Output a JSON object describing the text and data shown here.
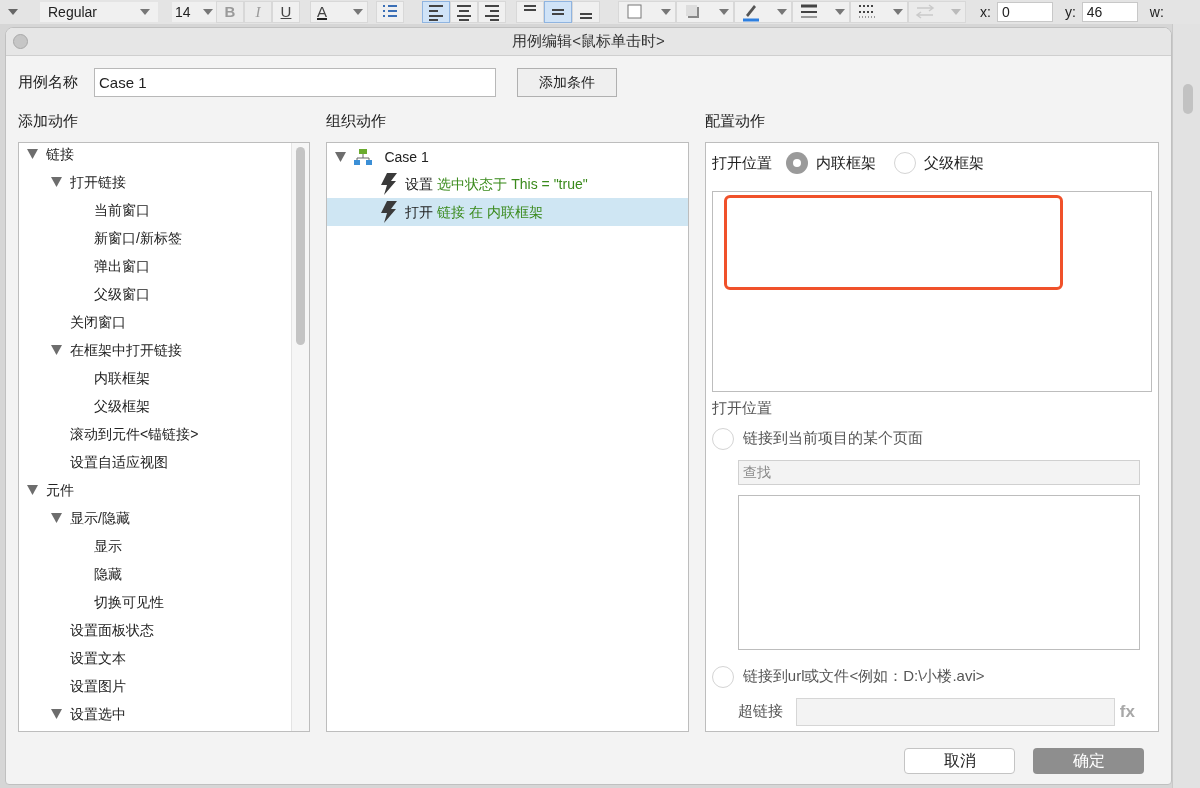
{
  "toolbar": {
    "font_style": "Regular",
    "font_size": "14",
    "buttons": [
      {
        "kind": "bold",
        "label": "B",
        "disabled": true,
        "selected": false
      },
      {
        "kind": "italic",
        "label": "I",
        "disabled": true,
        "selected": false
      },
      {
        "kind": "underline",
        "label": "U",
        "disabled": false,
        "selected": false
      },
      {
        "kind": "text-color",
        "label": "A",
        "disabled": false,
        "selected": false
      },
      {
        "kind": "list",
        "disabled": false,
        "selected": false
      },
      {
        "kind": "align-left",
        "disabled": false,
        "selected": true
      },
      {
        "kind": "align-center",
        "disabled": false,
        "selected": false
      },
      {
        "kind": "align-right",
        "disabled": false,
        "selected": false
      },
      {
        "kind": "valign-top",
        "disabled": false,
        "selected": false
      },
      {
        "kind": "valign-middle",
        "disabled": false,
        "selected": true
      },
      {
        "kind": "valign-bottom",
        "disabled": false,
        "selected": false
      },
      {
        "kind": "fill",
        "disabled": false,
        "selected": false
      },
      {
        "kind": "shadow",
        "disabled": false,
        "selected": false
      },
      {
        "kind": "line-color",
        "disabled": false,
        "selected": false
      },
      {
        "kind": "line-weight",
        "disabled": false,
        "selected": false
      },
      {
        "kind": "line-style",
        "disabled": false,
        "selected": false
      },
      {
        "kind": "arrow-style",
        "disabled": true,
        "selected": false
      }
    ],
    "x_label": "x:",
    "x_value": "0",
    "y_label": "y:",
    "y_value": "46",
    "w_label": "w:"
  },
  "dialog": {
    "title": "用例编辑<鼠标单击时>",
    "case_name_label": "用例名称",
    "case_name": "Case 1",
    "add_condition_button": "添加条件",
    "add_actions": {
      "title": "添加动作",
      "tree": [
        {
          "label": "链接",
          "expanded": true,
          "children": [
            {
              "label": "打开链接",
              "expanded": true,
              "children": [
                {
                  "label": "当前窗口"
                },
                {
                  "label": "新窗口/新标签"
                },
                {
                  "label": "弹出窗口"
                },
                {
                  "label": "父级窗口"
                }
              ]
            },
            {
              "label": "关闭窗口"
            },
            {
              "label": "在框架中打开链接",
              "expanded": true,
              "children": [
                {
                  "label": "内联框架"
                },
                {
                  "label": "父级框架"
                }
              ]
            },
            {
              "label": "滚动到元件<锚链接>"
            },
            {
              "label": "设置自适应视图"
            }
          ]
        },
        {
          "label": "元件",
          "expanded": true,
          "children": [
            {
              "label": "显示/隐藏",
              "expanded": true,
              "children": [
                {
                  "label": "显示"
                },
                {
                  "label": "隐藏"
                },
                {
                  "label": "切换可见性"
                }
              ]
            },
            {
              "label": "设置面板状态"
            },
            {
              "label": "设置文本"
            },
            {
              "label": "设置图片"
            },
            {
              "label": "设置选中",
              "expanded": true
            }
          ]
        }
      ]
    },
    "organize_actions": {
      "title": "组织动作",
      "case": {
        "label": "Case 1",
        "expanded": true,
        "actions": [
          {
            "verb": "设置",
            "detail": "选中状态于 This = \"true\"",
            "selected": false
          },
          {
            "verb": "打开",
            "detail": "链接 在 内联框架",
            "selected": true
          }
        ]
      }
    },
    "configure_action": {
      "title": "配置动作",
      "frame_label": "打开位置",
      "frame_options": [
        {
          "label": "内联框架",
          "selected": true
        },
        {
          "label": "父级框架",
          "selected": false
        }
      ],
      "location_label": "打开位置",
      "link_options": [
        {
          "kind": "page",
          "label": "链接到当前项目的某个页面",
          "selected": false,
          "search_placeholder": "查找"
        },
        {
          "kind": "url",
          "label": "链接到url或文件<例如：D:\\小楼.avi>",
          "selected": false,
          "field_label": "超链接",
          "fx_label": "fx"
        }
      ]
    },
    "cancel_button": "取消",
    "ok_button": "确定"
  }
}
